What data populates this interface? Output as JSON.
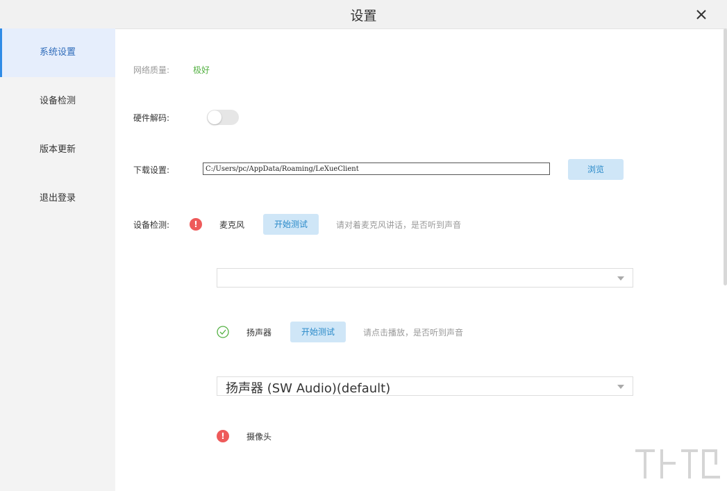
{
  "window": {
    "title": "设置"
  },
  "sidebar": {
    "items": [
      {
        "label": "系统设置"
      },
      {
        "label": "设备检测"
      },
      {
        "label": "版本更新"
      },
      {
        "label": "退出登录"
      }
    ]
  },
  "settings": {
    "network": {
      "label": "网络质量:",
      "value": "极好"
    },
    "hardware_decode": {
      "label": "硬件解码:",
      "enabled": false
    },
    "download": {
      "label": "下载设置:",
      "path": "C:/Users/pc/AppData/Roaming/LeXueClient",
      "browse_label": "浏览"
    },
    "device_check": {
      "label": "设备检测:",
      "microphone": {
        "name": "麦克风",
        "status": "error",
        "test_label": "开始测试",
        "hint": "请对着麦克风讲话，是否听到声音",
        "selected": ""
      },
      "speaker": {
        "name": "扬声器",
        "status": "ok",
        "test_label": "开始测试",
        "hint": "请点击播放，是否听到声音",
        "selected": "扬声器 (SW Audio)(default)"
      },
      "camera": {
        "name": "摄像头",
        "status": "error"
      }
    }
  },
  "colors": {
    "accent": "#2f8be6",
    "active_bg": "#e6eefc",
    "button_bg": "#cfe6f7",
    "button_text": "#2a8ac9",
    "good": "#55b144",
    "error": "#ee5a5a",
    "ok": "#55b144"
  }
}
